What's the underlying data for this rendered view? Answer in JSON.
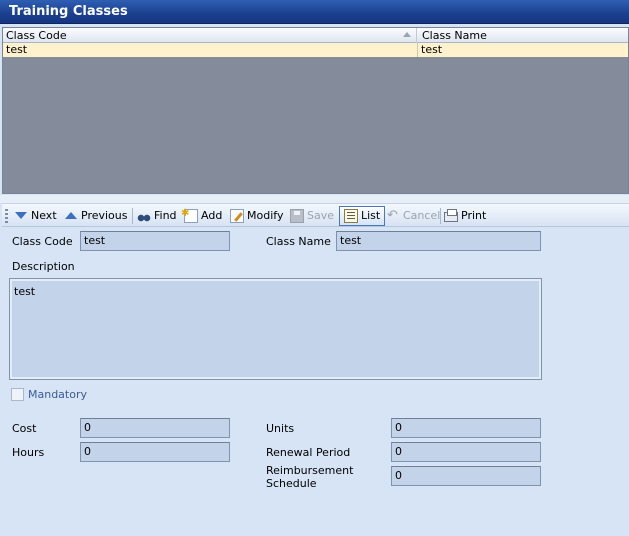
{
  "window": {
    "title": "Training Classes"
  },
  "grid": {
    "columns": [
      "Class Code",
      "Class Name"
    ],
    "rows": [
      {
        "class_code": "test",
        "class_name": "test"
      }
    ],
    "selected_row_color": "#fff2cd"
  },
  "toolbar": {
    "next": "Next",
    "previous": "Previous",
    "find": "Find",
    "add": "Add",
    "modify": "Modify",
    "save": "Save",
    "list": "List",
    "cancel": "Cancel",
    "print": "Print"
  },
  "form": {
    "class_code_label": "Class Code",
    "class_code_value": "test",
    "class_name_label": "Class Name",
    "class_name_value": "test",
    "description_label": "Description",
    "description_value": "test",
    "mandatory_label": "Mandatory",
    "mandatory_checked": false,
    "cost_label": "Cost",
    "cost_value": "0",
    "hours_label": "Hours",
    "hours_value": "0",
    "units_label": "Units",
    "units_value": "0",
    "renewal_label": "Renewal Period",
    "renewal_value": "0",
    "reimb_label_1": "Reimbursement",
    "reimb_label_2": "Schedule",
    "reimb_value": "0"
  },
  "colors": {
    "title_bar": "#1b3f8f",
    "grid_empty": "#848b9b",
    "panel": "#d6e4f5",
    "field": "#c3d4ea"
  }
}
